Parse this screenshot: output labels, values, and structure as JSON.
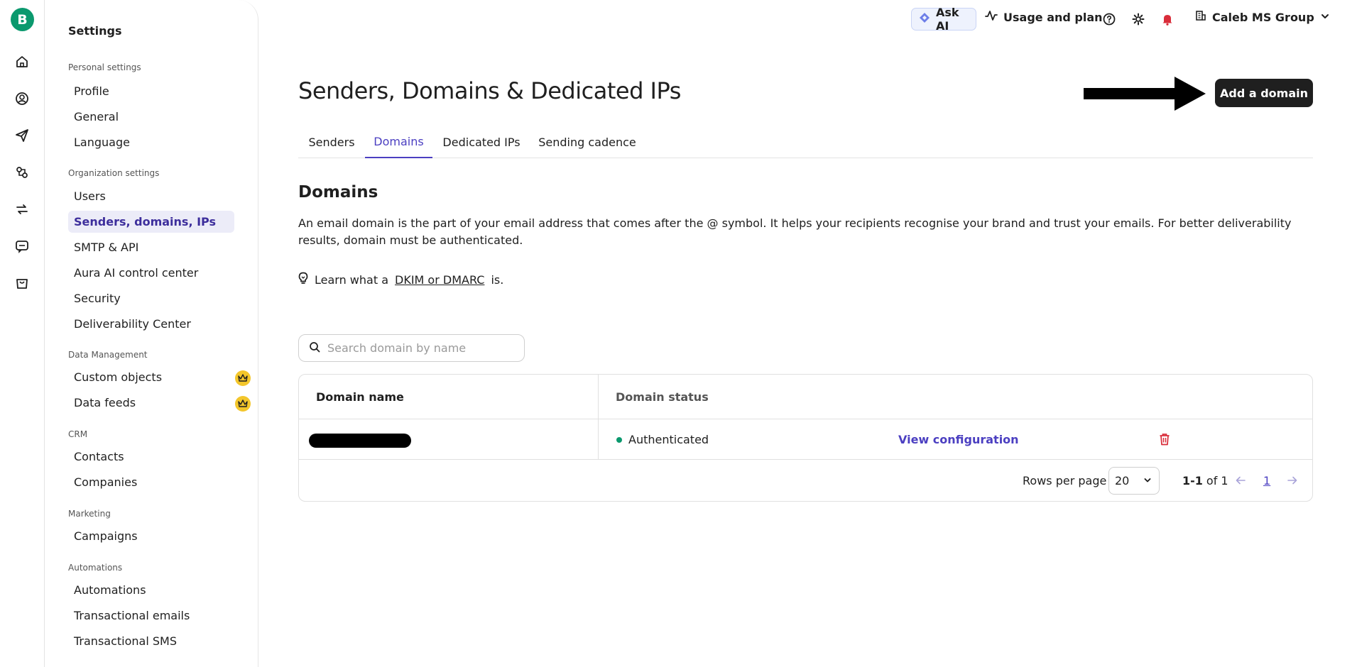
{
  "rail": {
    "logo_letter": "B",
    "icons": [
      "home-icon",
      "contacts-icon",
      "campaigns-icon",
      "automations-icon",
      "transactional-icon",
      "conversations-icon",
      "ecommerce-icon"
    ]
  },
  "sidebar": {
    "title": "Settings",
    "sections": [
      {
        "label": "Personal settings",
        "items": [
          "Profile",
          "General",
          "Language"
        ]
      },
      {
        "label": "Organization settings",
        "items": [
          "Users",
          "Senders, domains, IPs",
          "SMTP & API",
          "Aura AI control center",
          "Security",
          "Deliverability Center"
        ]
      },
      {
        "label": "Data Management",
        "items": [
          "Custom objects",
          "Data feeds"
        ]
      },
      {
        "label": "CRM",
        "items": [
          "Contacts",
          "Companies"
        ]
      },
      {
        "label": "Marketing",
        "items": [
          "Campaigns"
        ]
      },
      {
        "label": "Automations",
        "items": [
          "Automations",
          "Transactional emails",
          "Transactional SMS"
        ]
      }
    ],
    "active_item": "Senders, domains, IPs"
  },
  "topbar": {
    "ask_ai": "Ask AI",
    "usage": "Usage and plan",
    "org_name": "Caleb MS Group"
  },
  "page": {
    "title": "Senders, Domains & Dedicated IPs",
    "add_button": "Add a domain",
    "tabs": [
      "Senders",
      "Domains",
      "Dedicated IPs",
      "Sending cadence"
    ],
    "active_tab": "Domains",
    "section_title": "Domains",
    "description": "An email domain is the part of your email address that comes after the @ symbol. It helps your recipients recognise your brand and trust your emails. For better deliverability results, domain must be authenticated.",
    "learn_prefix": "Learn what a",
    "learn_link": "DKIM or DMARC",
    "learn_suffix": "is."
  },
  "search": {
    "placeholder": "Search domain by name",
    "value": ""
  },
  "table": {
    "headers": [
      "Domain name",
      "Domain status"
    ],
    "rows": [
      {
        "domain": "",
        "status": "Authenticated",
        "action": "View configuration"
      }
    ]
  },
  "pagination": {
    "rows_per_page_label": "Rows per page",
    "rows_per_page_value": "20",
    "range_bold": "1-1",
    "range_suffix": "of 1",
    "current_page": "1"
  },
  "colors": {
    "accent": "#4b3fc1",
    "brand": "#0b996e",
    "status_authenticated": "#0b996e",
    "danger": "#d92d3a",
    "crown": "#f3c62b"
  }
}
